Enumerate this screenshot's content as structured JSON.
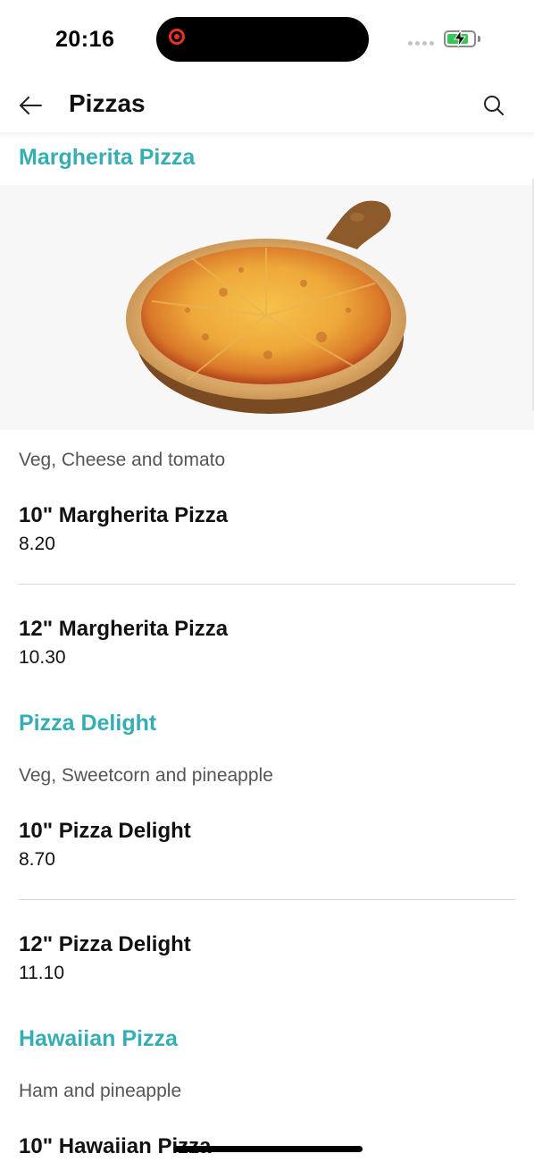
{
  "status_bar": {
    "time": "20:16"
  },
  "header": {
    "title": "Pizzas"
  },
  "colors": {
    "accent": "#35aeb3",
    "recording": "#e4312a",
    "battery": "#36c759"
  },
  "categories": [
    {
      "title": "Margherita Pizza",
      "description": "Veg, Cheese and tomato",
      "items": [
        {
          "name": "10\" Margherita Pizza",
          "price": "8.20"
        },
        {
          "name": "12\" Margherita Pizza",
          "price": "10.30"
        }
      ]
    },
    {
      "title": "Pizza Delight",
      "description": "Veg, Sweetcorn and pineapple",
      "items": [
        {
          "name": "10\" Pizza Delight",
          "price": "8.70"
        },
        {
          "name": "12\" Pizza Delight",
          "price": "11.10"
        }
      ]
    },
    {
      "title": "Hawaiian Pizza",
      "description": "Ham and pineapple",
      "items": [
        {
          "name": "10\" Hawaiian Pizza",
          "price": ""
        }
      ]
    }
  ],
  "icons": {
    "back": "arrow-left-icon",
    "search": "search-icon",
    "record": "record-icon",
    "battery": "battery-icon"
  }
}
